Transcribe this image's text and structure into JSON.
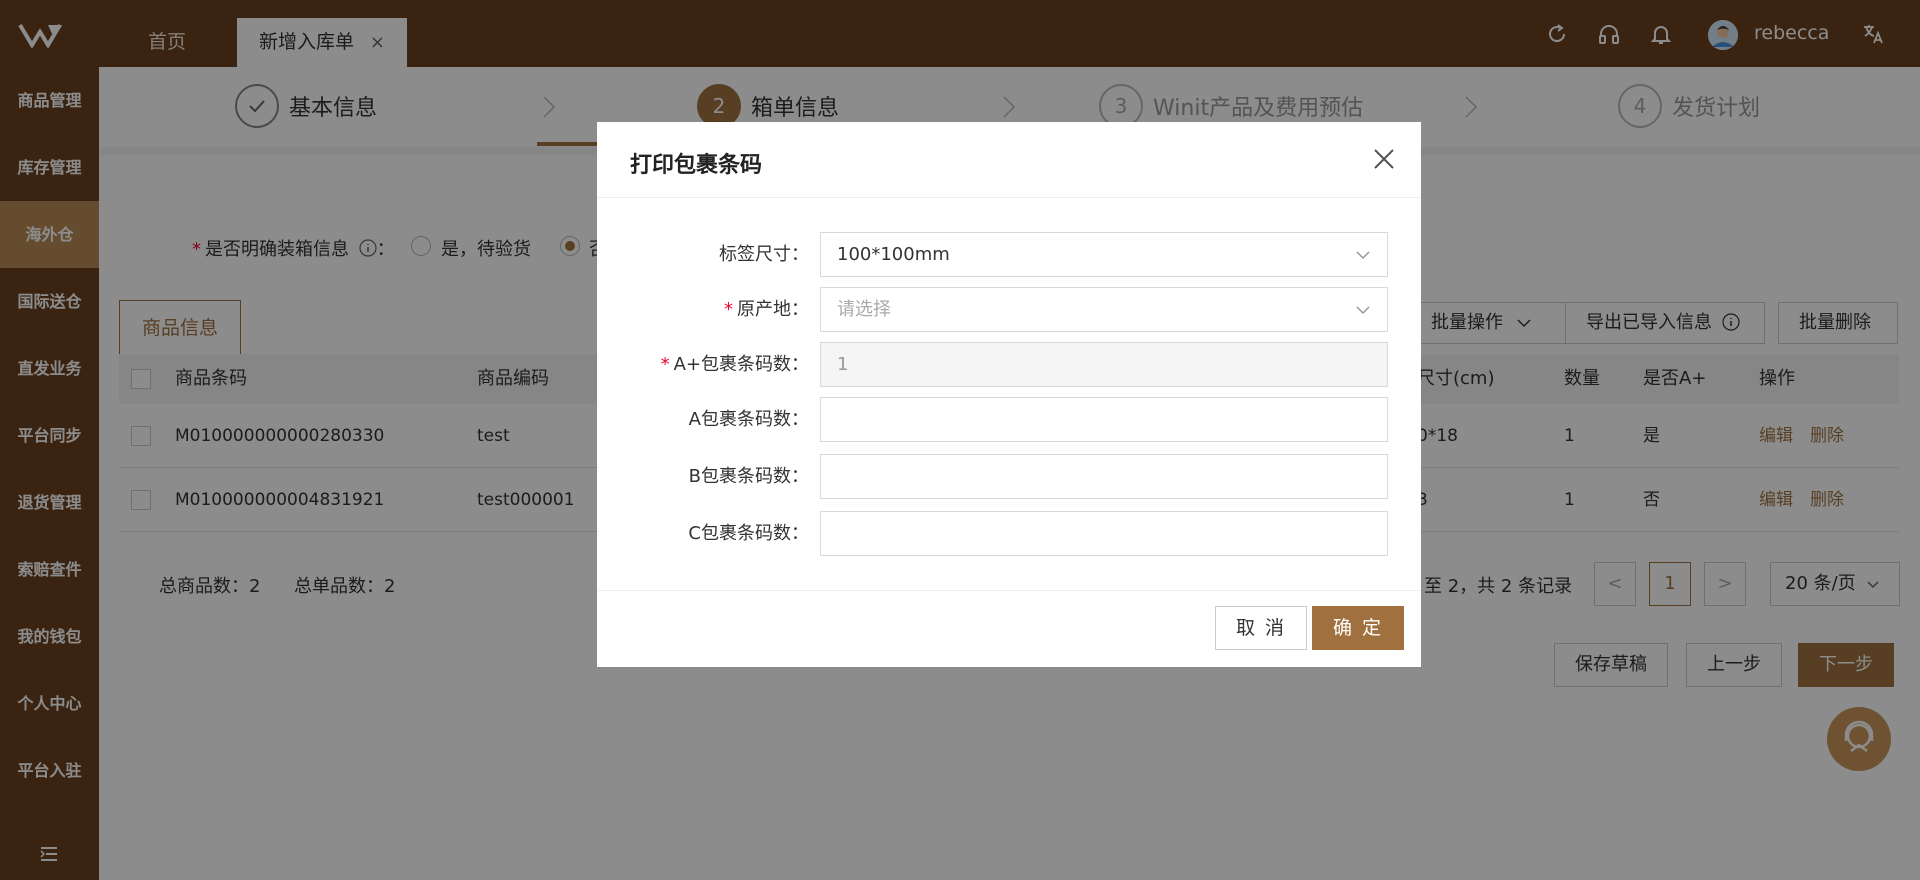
{
  "topbar": {
    "home_tab": "首页",
    "active_tab": "新增入库单",
    "tab_close": "×",
    "username": "rebecca"
  },
  "sidebar": {
    "items": [
      {
        "label": "商品管理"
      },
      {
        "label": "库存管理"
      },
      {
        "label": "海外仓"
      },
      {
        "label": "国际送仓"
      },
      {
        "label": "直发业务"
      },
      {
        "label": "平台同步"
      },
      {
        "label": "退货管理"
      },
      {
        "label": "索赔查件"
      },
      {
        "label": "我的钱包"
      },
      {
        "label": "个人中心"
      },
      {
        "label": "平台入驻"
      }
    ]
  },
  "steps": [
    {
      "label": "基本信息",
      "num": ""
    },
    {
      "label": "箱单信息",
      "num": "2"
    },
    {
      "label": "Winit产品及费用预估",
      "num": "3"
    },
    {
      "label": "发货计划",
      "num": "4"
    }
  ],
  "form": {
    "question": "是否明确装箱信息",
    "colon": "：",
    "option_yes": "是，待验货",
    "option_no": "否"
  },
  "product_tab": "商品信息",
  "right_buttons": {
    "batch_ops": "批量操作",
    "export_imported": "导出已导入信息",
    "batch_delete": "批量删除"
  },
  "table": {
    "headers": {
      "barcode": "商品条码",
      "code": "商品编码",
      "size": "尺寸(cm)",
      "qty": "数量",
      "aplus": "是否A+",
      "ops": "操作"
    },
    "rows": [
      {
        "barcode": "M010000000000280330",
        "code": "test",
        "size": "0*18",
        "qty": "1",
        "aplus": "是",
        "edit": "编辑",
        "delete": "删除"
      },
      {
        "barcode": "M010000000004831921",
        "code": "test000001",
        "size": "3",
        "qty": "1",
        "aplus": "否",
        "edit": "编辑",
        "delete": "删除"
      }
    ]
  },
  "totals": {
    "product_count": "总商品数：2",
    "sku_count": "总单品数：2"
  },
  "pagination": {
    "summary": "至 2，共 2 条记录",
    "prev": "<",
    "current": "1",
    "next": ">",
    "page_size": "20 条/页"
  },
  "bottom_buttons": {
    "save_draft": "保存草稿",
    "prev_step": "上一步",
    "next_step": "下一步"
  },
  "modal": {
    "title": "打印包裹条码",
    "fields": {
      "label_size": {
        "label": "标签尺寸：",
        "value": "100*100mm"
      },
      "origin": {
        "label": "原产地：",
        "placeholder": "请选择"
      },
      "aplus_count": {
        "label": "A+包裹条码数：",
        "value": "1"
      },
      "a_count": {
        "label": "A包裹条码数：",
        "value": ""
      },
      "b_count": {
        "label": "B包裹条码数：",
        "value": ""
      },
      "c_count": {
        "label": "C包裹条码数：",
        "value": ""
      }
    },
    "cancel": "取 消",
    "confirm": "确 定"
  },
  "colors": {
    "brand_dark": "#6b4220",
    "accent": "#a0713e",
    "required": "#e03333"
  }
}
